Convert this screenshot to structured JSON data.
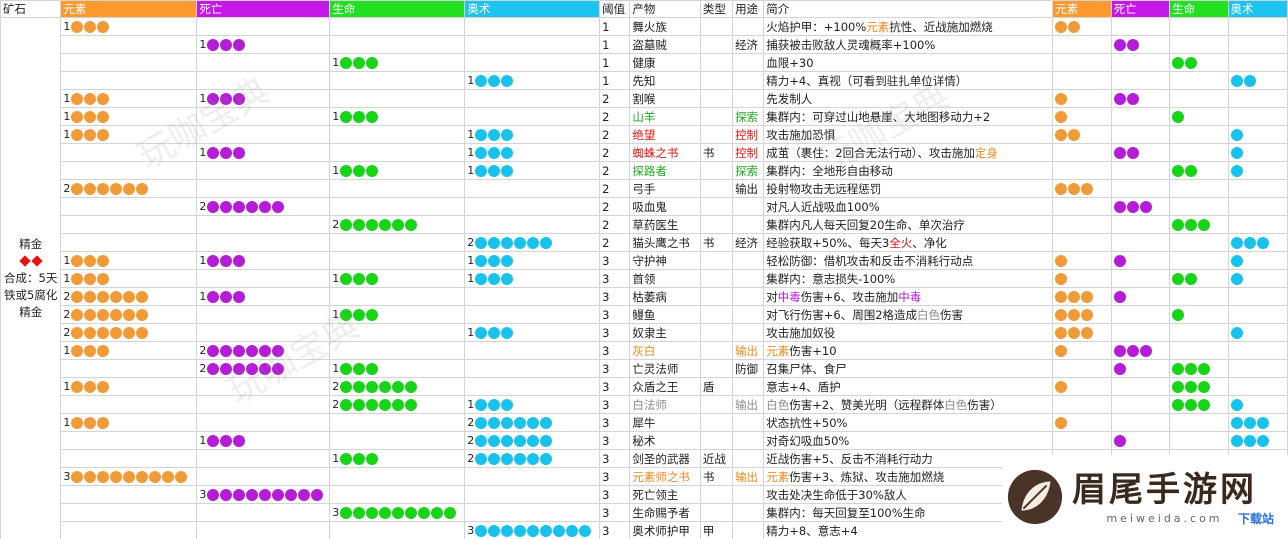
{
  "header": {
    "ore": "矿石",
    "elem": "元素",
    "death": "死亡",
    "life": "生命",
    "arcane": "奥术",
    "threshold": "阈值",
    "product": "产物",
    "type": "类型",
    "use": "用途",
    "desc": "简介",
    "elem2": "元素",
    "death2": "死亡",
    "life2": "生命",
    "arcane2": "奥术"
  },
  "ore": {
    "name": "精金",
    "recipe": "合成：5天铁或5腐化精金"
  },
  "colors": {
    "elem": "#ff9a2e",
    "death": "#c417e8",
    "life": "#20e020",
    "arcane": "#1ec4f0",
    "elem_dot": "#f09a38",
    "death_dot": "#b41cd6",
    "life_dot": "#18d418",
    "arcane_dot": "#18c2ec",
    "diamond": "#e81010"
  },
  "rows": [
    {
      "c": [
        1,
        0,
        0,
        0
      ],
      "t": "1",
      "p": "舞火族",
      "ty": "",
      "u": "",
      "d": [
        [
          "火焰护甲：+100%",
          ""
        ],
        [
          "元素",
          "o"
        ],
        [
          "抗性、近战施加燃烧",
          ""
        ]
      ],
      "r": [
        2,
        0,
        0,
        0
      ]
    },
    {
      "c": [
        0,
        1,
        0,
        0
      ],
      "t": "1",
      "p": "盗墓贼",
      "ty": "",
      "u": "经济",
      "d": [
        [
          "捕获被击败敌人灵魂概率+100%",
          ""
        ]
      ],
      "r": [
        0,
        2,
        0,
        0
      ]
    },
    {
      "c": [
        0,
        0,
        1,
        0
      ],
      "t": "1",
      "p": "健康",
      "ty": "",
      "u": "",
      "d": [
        [
          "血限+30",
          ""
        ]
      ],
      "r": [
        0,
        0,
        2,
        0
      ]
    },
    {
      "c": [
        0,
        0,
        0,
        1
      ],
      "t": "1",
      "p": "先知",
      "ty": "",
      "u": "",
      "d": [
        [
          "精力+4、真视（可看到驻扎单位详情）",
          ""
        ]
      ],
      "r": [
        0,
        0,
        0,
        2
      ]
    },
    {
      "c": [
        1,
        1,
        0,
        0
      ],
      "t": "2",
      "p": "割喉",
      "ty": "",
      "u": "",
      "d": [
        [
          "先发制人",
          ""
        ]
      ],
      "r": [
        1,
        2,
        0,
        0
      ]
    },
    {
      "c": [
        1,
        0,
        1,
        0
      ],
      "t": "2",
      "p": "山羊",
      "pc": "g",
      "ty": "",
      "u": "探索",
      "uc": "g",
      "d": [
        [
          "集群内：可穿过山地悬崖、大地图移动力+2",
          ""
        ]
      ],
      "r": [
        1,
        0,
        1,
        0
      ]
    },
    {
      "c": [
        1,
        0,
        0,
        1
      ],
      "t": "2",
      "p": "绝望",
      "pc": "r",
      "ty": "",
      "u": "控制",
      "uc": "r",
      "d": [
        [
          "攻击施加恐惧",
          ""
        ]
      ],
      "r": [
        2,
        0,
        0,
        1
      ]
    },
    {
      "c": [
        0,
        1,
        0,
        1
      ],
      "t": "2",
      "p": "蜘蛛之书",
      "pc": "r",
      "ty": "书",
      "u": "控制",
      "uc": "r",
      "d": [
        [
          "成茧（裹住：2回合无法行动）、攻击施加",
          ""
        ],
        [
          "定身",
          "o"
        ]
      ],
      "r": [
        0,
        2,
        0,
        1
      ]
    },
    {
      "c": [
        0,
        0,
        1,
        1
      ],
      "t": "2",
      "p": "探路者",
      "pc": "g",
      "ty": "",
      "u": "探索",
      "uc": "g",
      "d": [
        [
          "集群内：全地形自由移动",
          ""
        ]
      ],
      "r": [
        0,
        0,
        2,
        1
      ]
    },
    {
      "c": [
        2,
        0,
        0,
        0
      ],
      "t": "2",
      "p": "弓手",
      "ty": "",
      "u": "输出",
      "d": [
        [
          "投射物攻击无远程惩罚",
          ""
        ]
      ],
      "r": [
        3,
        0,
        0,
        0
      ]
    },
    {
      "c": [
        0,
        2,
        0,
        0
      ],
      "t": "2",
      "p": "吸血鬼",
      "ty": "",
      "u": "",
      "d": [
        [
          "对凡人近战吸血100%",
          ""
        ]
      ],
      "r": [
        0,
        3,
        0,
        0
      ]
    },
    {
      "c": [
        0,
        0,
        2,
        0
      ],
      "t": "2",
      "p": "草药医生",
      "ty": "",
      "u": "",
      "d": [
        [
          "集群内凡人每天回复20生命、单次治疗",
          ""
        ]
      ],
      "r": [
        0,
        0,
        3,
        0
      ]
    },
    {
      "c": [
        0,
        0,
        0,
        2
      ],
      "t": "2",
      "p": "猫头鹰之书",
      "ty": "书",
      "u": "经济",
      "d": [
        [
          "经验获取+50%、每天3",
          ""
        ],
        [
          "全火",
          "r"
        ],
        [
          "、净化",
          ""
        ]
      ],
      "r": [
        0,
        0,
        0,
        3
      ]
    },
    {
      "c": [
        1,
        1,
        0,
        1
      ],
      "t": "3",
      "p": "守护神",
      "ty": "",
      "u": "",
      "d": [
        [
          "轻松防御：借机攻击和反击不消耗行动点",
          ""
        ]
      ],
      "r": [
        1,
        1,
        0,
        1
      ]
    },
    {
      "c": [
        1,
        0,
        1,
        1
      ],
      "t": "3",
      "p": "首领",
      "ty": "",
      "u": "",
      "d": [
        [
          "集群内：意志损失-100%",
          ""
        ]
      ],
      "r": [
        1,
        0,
        2,
        1
      ]
    },
    {
      "c": [
        2,
        1,
        0,
        0
      ],
      "t": "3",
      "p": "枯萎病",
      "ty": "",
      "u": "",
      "d": [
        [
          "对",
          ""
        ],
        [
          "中毒",
          "p"
        ],
        [
          "伤害+6、攻击施加",
          ""
        ],
        [
          "中毒",
          "p"
        ]
      ],
      "r": [
        3,
        1,
        0,
        0
      ]
    },
    {
      "c": [
        2,
        0,
        1,
        0
      ],
      "t": "3",
      "p": "鳗鱼",
      "ty": "",
      "u": "",
      "d": [
        [
          "对飞行伤害+6、周围2格造成",
          ""
        ],
        [
          "白色",
          "gr"
        ],
        [
          "伤害",
          ""
        ]
      ],
      "r": [
        3,
        0,
        1,
        0
      ]
    },
    {
      "c": [
        2,
        0,
        0,
        1
      ],
      "t": "3",
      "p": "奴隶主",
      "ty": "",
      "u": "",
      "d": [
        [
          "攻击施加奴役",
          ""
        ]
      ],
      "r": [
        3,
        0,
        0,
        1
      ]
    },
    {
      "c": [
        1,
        2,
        0,
        0
      ],
      "t": "3",
      "p": "灰白",
      "pc": "o",
      "ty": "",
      "u": "输出",
      "uc": "o",
      "d": [
        [
          "元素",
          "o"
        ],
        [
          "伤害+10",
          ""
        ]
      ],
      "r": [
        1,
        3,
        0,
        0
      ]
    },
    {
      "c": [
        0,
        2,
        1,
        0
      ],
      "t": "3",
      "p": "亡灵法师",
      "ty": "",
      "u": "防御",
      "d": [
        [
          "召集尸体、食尸",
          ""
        ]
      ],
      "r": [
        0,
        1,
        3,
        0
      ]
    },
    {
      "c": [
        1,
        0,
        2,
        0
      ],
      "t": "3",
      "p": "众盾之王",
      "ty": "盾",
      "u": "",
      "d": [
        [
          "意志+4、盾护",
          ""
        ]
      ],
      "r": [
        1,
        0,
        3,
        0
      ]
    },
    {
      "c": [
        0,
        0,
        2,
        1
      ],
      "t": "3",
      "p": "白法师",
      "pc": "gr",
      "ty": "",
      "u": "输出",
      "uc": "gr",
      "d": [
        [
          "白色",
          "gr"
        ],
        [
          "伤害+2、赞美光明（远程群体",
          ""
        ],
        [
          "白色",
          "gr"
        ],
        [
          "伤害）",
          ""
        ]
      ],
      "r": [
        0,
        0,
        3,
        1
      ]
    },
    {
      "c": [
        1,
        0,
        0,
        2
      ],
      "t": "3",
      "p": "犀牛",
      "ty": "",
      "u": "",
      "d": [
        [
          "状态抗性+50%",
          ""
        ]
      ],
      "r": [
        1,
        0,
        0,
        3
      ]
    },
    {
      "c": [
        0,
        1,
        0,
        2
      ],
      "t": "3",
      "p": "秘术",
      "ty": "",
      "u": "",
      "d": [
        [
          "对奇幻吸血50%",
          ""
        ]
      ],
      "r": [
        0,
        1,
        0,
        3
      ]
    },
    {
      "c": [
        0,
        0,
        1,
        2
      ],
      "t": "3",
      "p": "剑圣的武器",
      "ty": "近战",
      "u": "",
      "d": [
        [
          "近战伤害+5、反击不消耗行动力",
          ""
        ]
      ],
      "r": [
        0,
        0,
        0,
        0
      ]
    },
    {
      "c": [
        3,
        0,
        0,
        0
      ],
      "t": "3",
      "p": "元素师之书",
      "pc": "o",
      "ty": "书",
      "u": "输出",
      "uc": "o",
      "d": [
        [
          "元素",
          "o"
        ],
        [
          "伤害+3、炼狱、攻击施加燃烧",
          ""
        ]
      ],
      "r": [
        0,
        0,
        0,
        0
      ]
    },
    {
      "c": [
        0,
        3,
        0,
        0
      ],
      "t": "3",
      "p": "死亡领主",
      "ty": "",
      "u": "",
      "d": [
        [
          "攻击处决生命低于30%敌人",
          ""
        ]
      ],
      "r": [
        0,
        0,
        0,
        0
      ]
    },
    {
      "c": [
        0,
        0,
        3,
        0
      ],
      "t": "3",
      "p": "生命赐予者",
      "ty": "",
      "u": "",
      "d": [
        [
          "集群内：每天回复至100%生命",
          ""
        ]
      ],
      "r": [
        0,
        0,
        0,
        0
      ]
    },
    {
      "c": [
        0,
        0,
        0,
        3
      ],
      "t": "3",
      "p": "奥术师护甲",
      "ty": "甲",
      "u": "",
      "d": [
        [
          "精力+8、意志+4",
          ""
        ]
      ],
      "r": [
        0,
        0,
        0,
        0
      ]
    }
  ],
  "watermarks": [
    "玩咖宝典",
    "玩咖宝典",
    "玩咖宝典"
  ],
  "logo": {
    "name": "眉尾手游网",
    "url": "meiweida.com",
    "badge": "下载站"
  }
}
